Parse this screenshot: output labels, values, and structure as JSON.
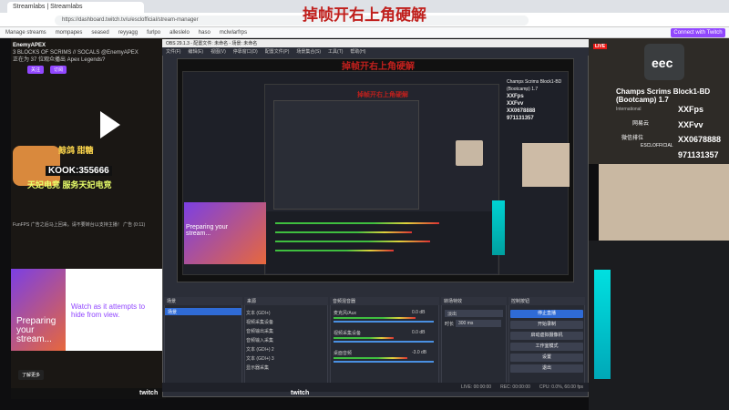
{
  "browser": {
    "tab_title": "Streamlabs | Streamlabs",
    "url": "https://dashboard.twitch.tv/u/esclofficial/stream-manager",
    "overlay_title": "掉帧开右上角硬解",
    "bookmarks": [
      "Manage streams",
      "mompapes",
      "seased",
      "reyyagg",
      "furlpo",
      "alleslelo",
      "haso",
      "mclwlarfrps"
    ],
    "connect_label": "Connect with Twitch"
  },
  "left_stream": {
    "channel": "EnemyAPEX",
    "headline": "3 BLOCKS OF SCRIMS // SOCALS @EnemyAPEX",
    "meta": "正在为 37 位观众播出 Apex Legends?",
    "follow_label": "关注",
    "subscribe_label": "订阅",
    "promo_line1": "鲸鸽 甜糖",
    "promo_code": "KOOK:355666",
    "promo_line2": "天妃电竞 服务天妃电竞",
    "ad_notice": "FunFPS 广告之后马上回来。请不要转台以支持主播！ 广告 (0:11)",
    "card_preparing": "Preparing your stream...",
    "card_watch": "Watch as it attempts to hide from view.",
    "learn_more": "了解更多"
  },
  "obs": {
    "title": "OBS 29.1.3 - 配置文件: 未命名 - 场景: 未命名",
    "menu": [
      "文件(F)",
      "编辑(E)",
      "视图(V)",
      "停靠窗口(D)",
      "配置文件(P)",
      "场景集合(S)",
      "工具(T)",
      "帮助(H)"
    ],
    "nested_title": "掉帧开右上角硬解",
    "nested_title2": "掉帧开右上角硬解",
    "preview_right_title": "Champs Scrims Block1-BD (Bootcamp) 1.7",
    "preview_right_fps": "XXFps",
    "preview_right_fvv": "XXFvv",
    "preview_right_code": "XX0678888",
    "preview_right_num": "971131357",
    "preview_rec": "REC",
    "card_text": "Preparing your stream...",
    "toolbar_labels": [
      "未选择源",
      "属性",
      "滤镜"
    ],
    "docks": {
      "scenes": {
        "header": "场景",
        "items": [
          "场景"
        ]
      },
      "sources": {
        "header": "来源",
        "items": [
          "文本 (GDI+)",
          "视频采集设备",
          "音频输出采集",
          "音频输入采集",
          "文本 (GDI+) 2",
          "文本 (GDI+) 3",
          "显示器采集"
        ]
      },
      "mixer": {
        "header": "音频混音器",
        "channels": [
          {
            "name": "麦克风/Aux",
            "level": "0.0 dB",
            "fill": 0.82
          },
          {
            "name": "视频采集设备",
            "level": "0.0 dB",
            "fill": 0.6
          },
          {
            "name": "桌面音频",
            "level": "-3.0 dB",
            "fill": 0.74
          }
        ]
      },
      "transitions": {
        "header": "转场特效",
        "mode": "淡出",
        "duration_label": "时长",
        "duration": "300 ms"
      },
      "controls": {
        "header": "控制按钮",
        "buttons": [
          "停止直播",
          "开始录制",
          "启动虚拟摄像机",
          "工作室模式",
          "设置",
          "退出"
        ]
      }
    },
    "status": {
      "live": "LIVE: 00:00:00",
      "rec": "REC: 00:00:00",
      "cpu": "CPU: 0.0%, 60.00 fps"
    }
  },
  "right_stream": {
    "live_badge": "LIVE",
    "title": "Champs Scrims Block1-BD (Bootcamp) 1.7",
    "subtitle": "International",
    "fps": "XXFps",
    "fvv": "XXFvv",
    "code": "XX0678888",
    "num": "971131357",
    "tag1": "网易云",
    "tag2": "微信排位",
    "esc": "ESCLOFFICIAL"
  },
  "twitch_brand": "twitch"
}
